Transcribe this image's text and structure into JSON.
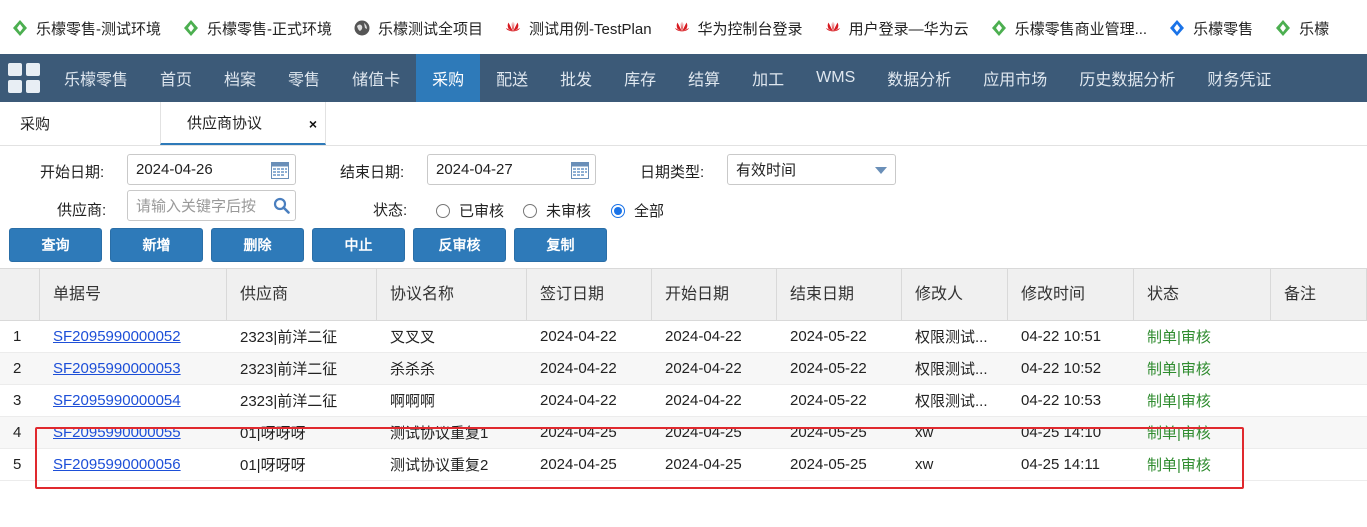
{
  "bookmarks": [
    {
      "label": "乐檬零售-测试环境",
      "icon": "lemon-diamond-icon"
    },
    {
      "label": "乐檬零售-正式环境",
      "icon": "lemon-diamond-icon"
    },
    {
      "label": "乐檬测试全项目",
      "icon": "globe-icon"
    },
    {
      "label": "测试用例-TestPlan",
      "icon": "huawei-icon"
    },
    {
      "label": "华为控制台登录",
      "icon": "huawei-icon"
    },
    {
      "label": "用户登录—华为云",
      "icon": "huawei-icon"
    },
    {
      "label": "乐檬零售商业管理...",
      "icon": "lemon-diamond-icon"
    },
    {
      "label": "乐檬零售",
      "icon": "blue-diamond-icon"
    },
    {
      "label": "乐檬",
      "icon": "lemon-diamond-icon"
    }
  ],
  "colors": {
    "nav_bg": "#3c5a78",
    "nav_active": "#2e7ab9",
    "button": "#2e7ab9",
    "link": "#1d4fd8",
    "status_green": "#2e8b2e",
    "highlight_red": "#e0292e"
  },
  "nav": {
    "brand": "乐檬零售",
    "items": [
      "首页",
      "档案",
      "零售",
      "储值卡",
      "采购",
      "配送",
      "批发",
      "库存",
      "结算",
      "加工",
      "WMS",
      "数据分析",
      "应用市场",
      "历史数据分析",
      "财务凭证"
    ],
    "active": "采购"
  },
  "tabs": {
    "first": "采购",
    "second": "供应商协议",
    "close": "×"
  },
  "filters": {
    "start_date_label": "开始日期:",
    "start_date": "2024-04-26",
    "end_date_label": "结束日期:",
    "end_date": "2024-04-27",
    "date_type_label": "日期类型:",
    "date_type": "有效时间",
    "supplier_label": "供应商:",
    "supplier_placeholder": "请输入关键字后按",
    "status_label": "状态:",
    "status_options": [
      "已审核",
      "未审核",
      "全部"
    ],
    "status_selected": "全部"
  },
  "buttons": {
    "query": "查询",
    "add": "新增",
    "delete": "删除",
    "stop": "中止",
    "unaudit": "反审核",
    "copy": "复制"
  },
  "table": {
    "headers": [
      "",
      "单据号",
      "供应商",
      "协议名称",
      "签订日期",
      "开始日期",
      "结束日期",
      "修改人",
      "修改时间",
      "状态",
      "备注"
    ],
    "rows": [
      [
        "1",
        "SF2095990000052",
        "2323|前洋二征",
        "叉叉叉",
        "2024-04-22",
        "2024-04-22",
        "2024-05-22",
        "权限测试...",
        "04-22 10:51",
        "制单|审核",
        ""
      ],
      [
        "2",
        "SF2095990000053",
        "2323|前洋二征",
        "杀杀杀",
        "2024-04-22",
        "2024-04-22",
        "2024-05-22",
        "权限测试...",
        "04-22 10:52",
        "制单|审核",
        ""
      ],
      [
        "3",
        "SF2095990000054",
        "2323|前洋二征",
        "啊啊啊",
        "2024-04-22",
        "2024-04-22",
        "2024-05-22",
        "权限测试...",
        "04-22 10:53",
        "制单|审核",
        ""
      ],
      [
        "4",
        "SF2095990000055",
        "01|呀呀呀",
        "测试协议重复1",
        "2024-04-25",
        "2024-04-25",
        "2024-05-25",
        "xw",
        "04-25 14:10",
        "制单|审核",
        ""
      ],
      [
        "5",
        "SF2095990000056",
        "01|呀呀呀",
        "测试协议重复2",
        "2024-04-25",
        "2024-04-25",
        "2024-05-25",
        "xw",
        "04-25 14:11",
        "制单|审核",
        ""
      ]
    ]
  }
}
